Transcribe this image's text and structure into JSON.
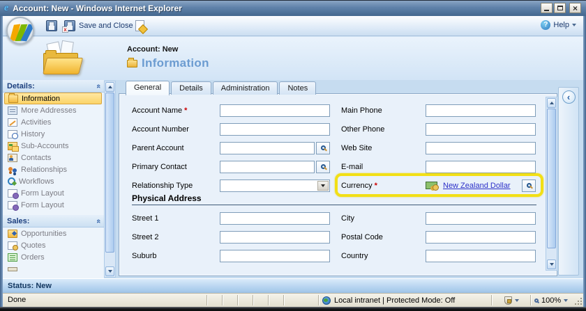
{
  "window": {
    "title": "Account: New - Windows Internet Explorer"
  },
  "toolbar": {
    "save_and_close": "Save and Close",
    "help": "Help"
  },
  "header": {
    "record": "Account: New",
    "page": "Information"
  },
  "sidebar": {
    "sections": [
      {
        "label": "Details:",
        "items": [
          {
            "label": "Information",
            "icon": "information-icon",
            "selected": true
          },
          {
            "label": "More Addresses",
            "icon": "more-addresses-icon"
          },
          {
            "label": "Activities",
            "icon": "activities-icon"
          },
          {
            "label": "History",
            "icon": "history-icon"
          },
          {
            "label": "Sub-Accounts",
            "icon": "sub-accounts-icon"
          },
          {
            "label": "Contacts",
            "icon": "contacts-icon"
          },
          {
            "label": "Relationships",
            "icon": "relationships-icon"
          },
          {
            "label": "Workflows",
            "icon": "workflows-icon"
          },
          {
            "label": "Form Layout",
            "icon": "form-layout-icon"
          },
          {
            "label": "Form Layout",
            "icon": "form-layout-icon"
          }
        ]
      },
      {
        "label": "Sales:",
        "items": [
          {
            "label": "Opportunities",
            "icon": "opportunities-icon"
          },
          {
            "label": "Quotes",
            "icon": "quotes-icon"
          },
          {
            "label": "Orders",
            "icon": "orders-icon"
          },
          {
            "label": "",
            "icon": "clipped-item-icon"
          }
        ]
      }
    ]
  },
  "tabs": [
    {
      "label": "General",
      "active": true
    },
    {
      "label": "Details",
      "active": false
    },
    {
      "label": "Administration",
      "active": false
    },
    {
      "label": "Notes",
      "active": false
    }
  ],
  "form": {
    "left": [
      {
        "label": "Account Name",
        "required": true,
        "control": "text",
        "value": ""
      },
      {
        "label": "Account Number",
        "control": "text",
        "value": ""
      },
      {
        "label": "Parent Account",
        "control": "lookup",
        "value": ""
      },
      {
        "label": "Primary Contact",
        "control": "lookup",
        "value": ""
      },
      {
        "label": "Relationship Type",
        "control": "select",
        "value": ""
      }
    ],
    "right": [
      {
        "label": "Main Phone",
        "control": "text",
        "value": ""
      },
      {
        "label": "Other Phone",
        "control": "text",
        "value": ""
      },
      {
        "label": "Web Site",
        "control": "text",
        "value": ""
      },
      {
        "label": "E-mail",
        "control": "text",
        "value": ""
      },
      {
        "label": "Currency",
        "required": true,
        "control": "currency",
        "value": "New Zealand Dollar",
        "highlighted": true
      }
    ],
    "address_section": {
      "title": "Physical Address"
    },
    "address_left": [
      {
        "label": "Street 1",
        "control": "text",
        "value": ""
      },
      {
        "label": "Street 2",
        "control": "text",
        "value": ""
      },
      {
        "label": "Suburb",
        "control": "text",
        "value": ""
      }
    ],
    "address_right": [
      {
        "label": "City",
        "control": "text",
        "value": ""
      },
      {
        "label": "Postal Code",
        "control": "text",
        "value": ""
      },
      {
        "label": "Country",
        "control": "text",
        "value": ""
      }
    ]
  },
  "status": {
    "label": "Status: New"
  },
  "browser_status": {
    "done": "Done",
    "zone": "Local intranet | Protected Mode: Off",
    "zoom": "100%"
  },
  "colors": {
    "highlight": "#F2DF16",
    "link": "#2B2FC8",
    "required": "#CC0000",
    "selected_item_bg": "#FBD468"
  }
}
